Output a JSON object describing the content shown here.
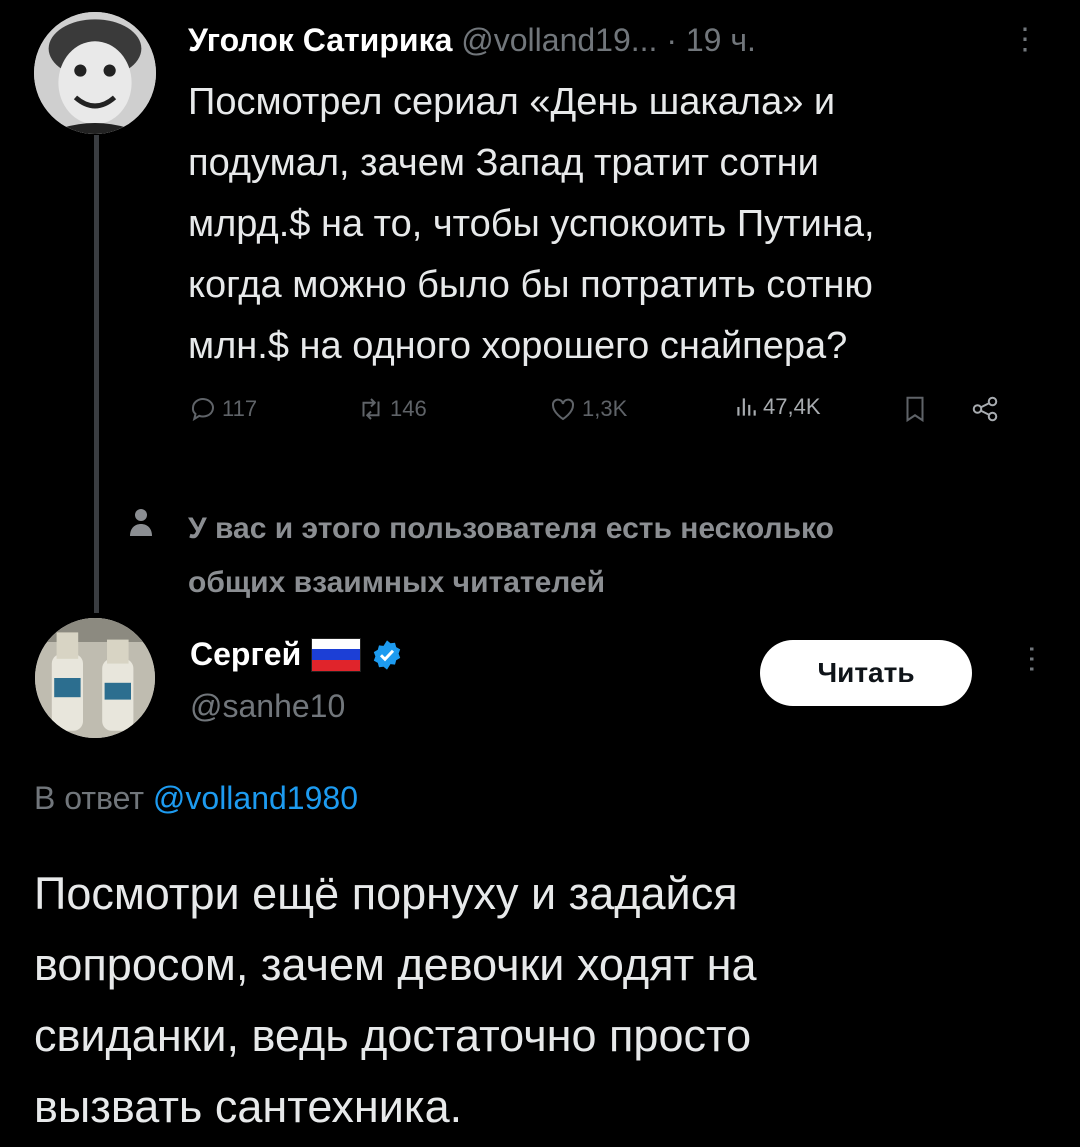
{
  "tweet1": {
    "author_name": "Уголок Сатирика",
    "handle": "@volland19...",
    "separator": "·",
    "time": "19 ч.",
    "more_icon": "vertical-dots-icon",
    "text": "Посмотрел сериал «День шакала» и\nподумал, зачем Запад тратит сотни\nмлрд.$ на то, чтобы успокоить Путина,\nкогда можно было бы потратить сотню\nмлн.$ на одного хорошего снайпера?",
    "actions": {
      "replies": "117",
      "retweets": "146",
      "likes": "1,3K",
      "views": "47,4K"
    }
  },
  "mutual_notice": "У вас и этого пользователя есть несколько\nобщих взаимных читателей",
  "user2": {
    "name": "Сергей",
    "handle": "@sanhe10",
    "follow_label": "Читать",
    "flag_colors": [
      "#ffffff",
      "#1c3fd6",
      "#e0242b"
    ],
    "verified_color": "#1d9bf0"
  },
  "reply": {
    "prefix": "В ответ",
    "mention": "@volland1980",
    "text": "Посмотри ещё порнуху и задайся\nвопросом, зачем девочки ходят на\nсвиданки, ведь достаточно просто\nвызвать сантехника."
  }
}
